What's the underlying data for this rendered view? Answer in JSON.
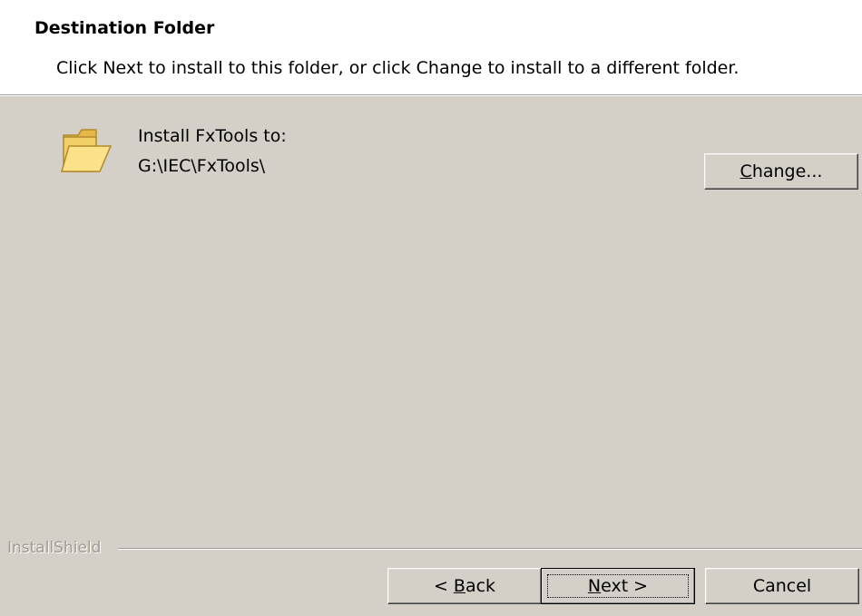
{
  "header": {
    "title": "Destination Folder",
    "description": "Click Next to install to this folder, or click Change to install to a different folder."
  },
  "destination": {
    "icon": "folder-icon",
    "label": "Install FxTools to:",
    "path": "G:\\IEC\\FxTools\\"
  },
  "buttons": {
    "change": {
      "mnemonic": "C",
      "rest": "hange..."
    },
    "back": {
      "prefix": "< ",
      "mnemonic": "B",
      "rest": "ack"
    },
    "next": {
      "mnemonic": "N",
      "rest": "ext >"
    },
    "cancel": "Cancel"
  },
  "footer": {
    "brand": "InstallShield"
  },
  "colors": {
    "dialog_bg": "#d4d0c8",
    "header_bg": "#ffffff",
    "folder_fill": "#f5d56a"
  }
}
